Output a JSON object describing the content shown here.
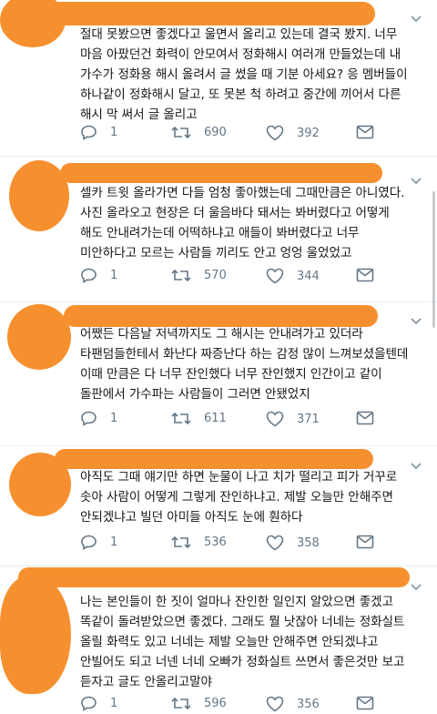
{
  "tweets": [
    {
      "text": "절대 못봤으면 좋겠다고 울면서 올리고 있는데 결국 봤지. 너무\n마음 아팠던건 화력이 안모여서 정화해시 여러개 만들었는데 내\n가수가 정화용 해시 올려서 글 썼을 때 기분 아세요? 응 멤버들이\n하나같이 정화해시 달고, 또 못본 척 하려고 중간에 끼어서 다른\n해시 막 써서 글 올리고",
      "replies": "1",
      "retweets": "690",
      "likes": "392"
    },
    {
      "text": "셀카 트윗 올라가면 다들 엄청 좋아했는데 그때만큼은 아니였다.\n사진 올라오고 현장은 더 울음바다 돼서는 봐버렸다고 어떻게\n해도 안내려가는데 어떡하냐고 애들이 봐버렸다고 너무\n미안하다고 모르는 사람들 끼리도 안고 엉엉 울었었고",
      "replies": "1",
      "retweets": "570",
      "likes": "344"
    },
    {
      "text": "어쨌든 다음날 저녁까지도 그 해시는 안내려가고 있더라\n타팬덤들한테서 화난다 짜증난다 하는 감정 많이 느껴보셨을텐데\n이때 만큼은 다 너무 잔인했다 너무 잔인했지 인간이고 같이\n돌판에서 가수파는 사람들이 그러면 안됐었지",
      "replies": "1",
      "retweets": "611",
      "likes": "371"
    },
    {
      "text": "아직도 그때 얘기만 하면 눈물이 나고 치가 떨리고 피가 거꾸로\n솟아 사람이 어떻게 그렇게 잔인하냐고. 제발 오늘만 안해주면\n안되겠냐고 빌던 아미들 아직도 눈에 훤하다",
      "replies": "1",
      "retweets": "536",
      "likes": "358"
    },
    {
      "text": "나는 본인들이 한 짓이 얼마나 잔인한 일인지 알았으면 좋겠고\n똑같이 돌려받았으면 좋겠다.  그래도 뭘 낫잖아 너네는 정화실트\n올릴 화력도 있고 너네는 제발 오늘만 안해주면 안되겠냐고\n안빌어도 되고 너넨 너네 오빠가 정화실트 쓰면서 좋은것만 보고\n듣자고 글도 안올리고말야",
      "replies": "1",
      "retweets": "596",
      "likes": "356"
    }
  ],
  "icons": {
    "reply": "reply-icon",
    "retweet": "retweet-icon",
    "like": "heart-icon",
    "dm": "envelope-icon",
    "more": "chevron-down-icon"
  },
  "colors": {
    "redaction": "#f6902f",
    "text": "#14171a",
    "icon": "#657786",
    "divider": "#e6ecf0"
  }
}
